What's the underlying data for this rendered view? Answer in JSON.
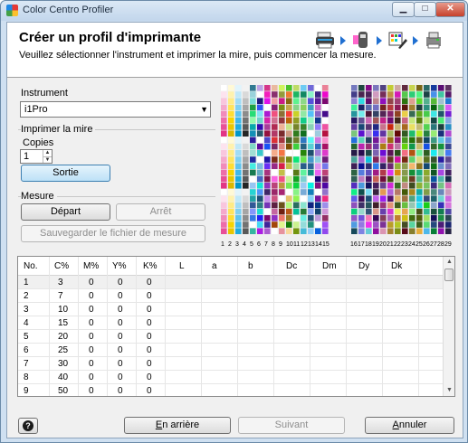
{
  "window": {
    "title": "Color Centro Profiler",
    "min_glyph": "▁",
    "max_glyph": "□",
    "close_glyph": "✕"
  },
  "header": {
    "title": "Créer un profil d'imprimante",
    "subtitle": "Veuillez sélectionner l'instrument et imprimer la mire, puis commencer la mesure.",
    "step_icons": [
      "printer-icon",
      "measuring-instrument-icon",
      "target-chart-icon",
      "tray-print-icon"
    ]
  },
  "instrument": {
    "label": "Instrument",
    "selected": "i1Pro"
  },
  "print_chart": {
    "label": "Imprimer la mire",
    "copies_label": "Copies",
    "copies_value": "1",
    "output_button": "Sortie"
  },
  "measure": {
    "label": "Mesure",
    "start_button": "Départ",
    "stop_button": "Arrêt",
    "save_button": "Sauvegarder le fichier de mesure"
  },
  "chart_columns_left": [
    "1",
    "2",
    "3",
    "4",
    "5",
    "6",
    "7",
    "8",
    "9",
    "10",
    "11",
    "12",
    "13",
    "14",
    "15"
  ],
  "chart_columns_right": [
    "16",
    "17",
    "18",
    "19",
    "20",
    "21",
    "22",
    "23",
    "24",
    "25",
    "26",
    "27",
    "28",
    "29"
  ],
  "table": {
    "columns": [
      "No.",
      "C%",
      "M%",
      "Y%",
      "K%",
      "L",
      "a",
      "b",
      "Dc",
      "Dm",
      "Dy",
      "Dk"
    ],
    "rows": [
      [
        "1",
        "3",
        "0",
        "0",
        "0"
      ],
      [
        "2",
        "7",
        "0",
        "0",
        "0"
      ],
      [
        "3",
        "10",
        "0",
        "0",
        "0"
      ],
      [
        "4",
        "15",
        "0",
        "0",
        "0"
      ],
      [
        "5",
        "20",
        "0",
        "0",
        "0"
      ],
      [
        "6",
        "25",
        "0",
        "0",
        "0"
      ],
      [
        "7",
        "30",
        "0",
        "0",
        "0"
      ],
      [
        "8",
        "40",
        "0",
        "0",
        "0"
      ],
      [
        "9",
        "50",
        "0",
        "0",
        "0"
      ]
    ]
  },
  "footer": {
    "help_glyph": "?",
    "back_prefix": "",
    "back_mnemonic": "E",
    "back_rest": "n arrière",
    "next_button": "Suivant",
    "cancel_mnemonic": "A",
    "cancel_rest": "nnuler"
  },
  "colors": {
    "accent": "#1f6fd1",
    "titlebar": "#cfe0f1",
    "selected_row": "#f0f0f0"
  }
}
